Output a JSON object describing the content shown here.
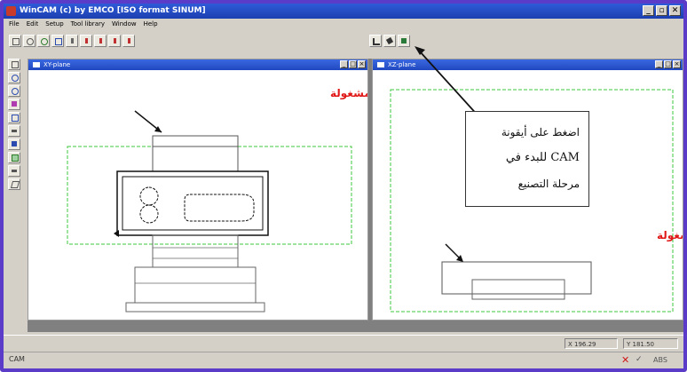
{
  "window": {
    "title": "WinCAM (c) by EMCO   [ISO format SINUM]",
    "min_glyph": "_",
    "restore_glyph": "▫",
    "close_glyph": "✕"
  },
  "menu": [
    "File",
    "Edit",
    "Setup",
    "Tool library",
    "Window",
    "Help"
  ],
  "toolbar_icons": [
    "new-file-icon",
    "open-file-icon",
    "save-file-icon",
    "window-icon",
    "tool-icon",
    "cut-icon",
    "copy-icon",
    "paste-icon",
    "print-icon",
    "cam-program-icon",
    "cam-icon",
    "simulation-icon"
  ],
  "left_toolbar_icons": [
    "select-icon",
    "zoom-in-icon",
    "zoom-out-icon",
    "view-icon",
    "layer-icon",
    "dimension-icon",
    "tool-path-icon",
    "workpiece-icon",
    "measure-icon",
    "3d-view-icon"
  ],
  "xy_window": {
    "title": "XY-plane"
  },
  "xz_window": {
    "title": "XZ-plane"
  },
  "annotations": {
    "xy_label": "المستوى(المسقط)X-Y للمشغولة",
    "xz_label": "المستوى(المسقط)X-Z للمشغولة"
  },
  "callout": {
    "line1": "اضغط على أيقونة",
    "line2": "CAM للبدء في",
    "line3": "مرحلة التصنيع"
  },
  "status": {
    "x": "X 196.29",
    "y": "Y 181.50",
    "mode": "CAM",
    "abs": "ABS"
  },
  "colors": {
    "accent": "#e01818",
    "titlebar": "#2048c0",
    "frame": "#5a3cc8"
  }
}
